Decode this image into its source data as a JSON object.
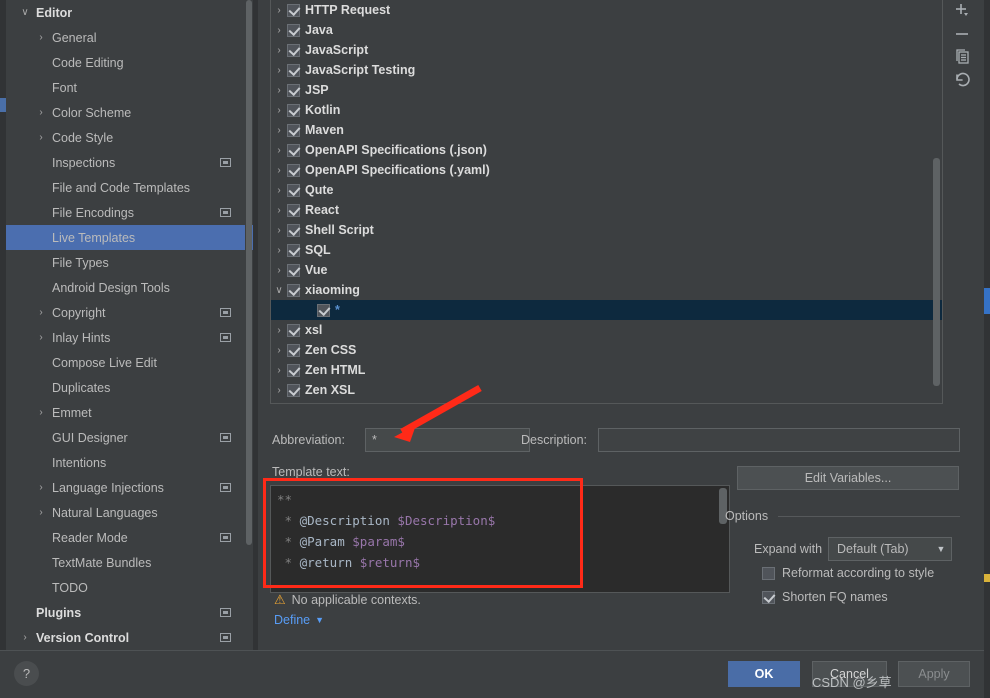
{
  "sidebar": {
    "items": [
      {
        "label": "Editor",
        "level": 0,
        "arrow": "chevron-down",
        "selected": false,
        "config": false
      },
      {
        "label": "General",
        "level": 1,
        "arrow": "chevron-right",
        "selected": false,
        "config": false
      },
      {
        "label": "Code Editing",
        "level": 1,
        "arrow": "",
        "selected": false,
        "config": false
      },
      {
        "label": "Font",
        "level": 1,
        "arrow": "",
        "selected": false,
        "config": false
      },
      {
        "label": "Color Scheme",
        "level": 1,
        "arrow": "chevron-right",
        "selected": false,
        "config": false
      },
      {
        "label": "Code Style",
        "level": 1,
        "arrow": "chevron-right",
        "selected": false,
        "config": false
      },
      {
        "label": "Inspections",
        "level": 1,
        "arrow": "",
        "selected": false,
        "config": true
      },
      {
        "label": "File and Code Templates",
        "level": 1,
        "arrow": "",
        "selected": false,
        "config": false
      },
      {
        "label": "File Encodings",
        "level": 1,
        "arrow": "",
        "selected": false,
        "config": true
      },
      {
        "label": "Live Templates",
        "level": 1,
        "arrow": "",
        "selected": true,
        "config": false
      },
      {
        "label": "File Types",
        "level": 1,
        "arrow": "",
        "selected": false,
        "config": false
      },
      {
        "label": "Android Design Tools",
        "level": 1,
        "arrow": "",
        "selected": false,
        "config": false
      },
      {
        "label": "Copyright",
        "level": 1,
        "arrow": "chevron-right",
        "selected": false,
        "config": true
      },
      {
        "label": "Inlay Hints",
        "level": 1,
        "arrow": "chevron-right",
        "selected": false,
        "config": true
      },
      {
        "label": "Compose Live Edit",
        "level": 1,
        "arrow": "",
        "selected": false,
        "config": false
      },
      {
        "label": "Duplicates",
        "level": 1,
        "arrow": "",
        "selected": false,
        "config": false
      },
      {
        "label": "Emmet",
        "level": 1,
        "arrow": "chevron-right",
        "selected": false,
        "config": false
      },
      {
        "label": "GUI Designer",
        "level": 1,
        "arrow": "",
        "selected": false,
        "config": true
      },
      {
        "label": "Intentions",
        "level": 1,
        "arrow": "",
        "selected": false,
        "config": false
      },
      {
        "label": "Language Injections",
        "level": 1,
        "arrow": "chevron-right",
        "selected": false,
        "config": true
      },
      {
        "label": "Natural Languages",
        "level": 1,
        "arrow": "chevron-right",
        "selected": false,
        "config": false
      },
      {
        "label": "Reader Mode",
        "level": 1,
        "arrow": "",
        "selected": false,
        "config": true
      },
      {
        "label": "TextMate Bundles",
        "level": 1,
        "arrow": "",
        "selected": false,
        "config": false
      },
      {
        "label": "TODO",
        "level": 1,
        "arrow": "",
        "selected": false,
        "config": false
      },
      {
        "label": "Plugins",
        "level": 0,
        "arrow": "",
        "selected": false,
        "config": true
      },
      {
        "label": "Version Control",
        "level": 0,
        "arrow": "chevron-right",
        "selected": false,
        "config": true
      }
    ]
  },
  "tree": {
    "rows": [
      {
        "label": "HTTP Request",
        "arrow": "chevron-right",
        "checked": true,
        "child": false,
        "selected": false
      },
      {
        "label": "Java",
        "arrow": "chevron-right",
        "checked": true,
        "child": false,
        "selected": false
      },
      {
        "label": "JavaScript",
        "arrow": "chevron-right",
        "checked": true,
        "child": false,
        "selected": false
      },
      {
        "label": "JavaScript Testing",
        "arrow": "chevron-right",
        "checked": true,
        "child": false,
        "selected": false
      },
      {
        "label": "JSP",
        "arrow": "chevron-right",
        "checked": true,
        "child": false,
        "selected": false
      },
      {
        "label": "Kotlin",
        "arrow": "chevron-right",
        "checked": true,
        "child": false,
        "selected": false
      },
      {
        "label": "Maven",
        "arrow": "chevron-right",
        "checked": true,
        "child": false,
        "selected": false
      },
      {
        "label": "OpenAPI Specifications (.json)",
        "arrow": "chevron-right",
        "checked": true,
        "child": false,
        "selected": false
      },
      {
        "label": "OpenAPI Specifications (.yaml)",
        "arrow": "chevron-right",
        "checked": true,
        "child": false,
        "selected": false
      },
      {
        "label": "Qute",
        "arrow": "chevron-right",
        "checked": true,
        "child": false,
        "selected": false
      },
      {
        "label": "React",
        "arrow": "chevron-right",
        "checked": true,
        "child": false,
        "selected": false
      },
      {
        "label": "Shell Script",
        "arrow": "chevron-right",
        "checked": true,
        "child": false,
        "selected": false
      },
      {
        "label": "SQL",
        "arrow": "chevron-right",
        "checked": true,
        "child": false,
        "selected": false
      },
      {
        "label": "Vue",
        "arrow": "chevron-right",
        "checked": true,
        "child": false,
        "selected": false
      },
      {
        "label": "xiaoming",
        "arrow": "chevron-down",
        "checked": true,
        "child": false,
        "selected": false
      },
      {
        "label": "*",
        "arrow": "",
        "checked": true,
        "child": true,
        "selected": true
      },
      {
        "label": "xsl",
        "arrow": "chevron-right",
        "checked": true,
        "child": false,
        "selected": false
      },
      {
        "label": "Zen CSS",
        "arrow": "chevron-right",
        "checked": true,
        "child": false,
        "selected": false
      },
      {
        "label": "Zen HTML",
        "arrow": "chevron-right",
        "checked": true,
        "child": false,
        "selected": false
      },
      {
        "label": "Zen XSL",
        "arrow": "chevron-right",
        "checked": true,
        "child": false,
        "selected": false
      }
    ]
  },
  "toolbar": {
    "add": "add-icon",
    "remove": "remove-icon",
    "duplicate": "duplicate-icon",
    "revert": "revert-icon"
  },
  "form": {
    "abbreviation_label": "Abbreviation:",
    "abbreviation_value": "*",
    "description_label": "Description:",
    "description_value": "",
    "template_text_label": "Template text:",
    "template_lines": [
      {
        "prefix": "**",
        "tag": "",
        "var": ""
      },
      {
        "prefix": " * ",
        "tag": "@Description ",
        "var": "$Description$"
      },
      {
        "prefix": " * ",
        "tag": "@Param ",
        "var": "$param$"
      },
      {
        "prefix": " * ",
        "tag": "@return ",
        "var": "$return$"
      }
    ],
    "warning": "No applicable contexts.",
    "define_label": "Define",
    "edit_variables_label": "Edit Variables...",
    "options_label": "Options",
    "expand_with_label": "Expand with",
    "expand_with_value": "Default (Tab)",
    "reformat_label": "Reformat according to style",
    "reformat_checked": false,
    "shorten_label": "Shorten FQ names",
    "shorten_checked": true
  },
  "footer": {
    "help": "?",
    "ok": "OK",
    "cancel": "Cancel",
    "apply": "Apply",
    "watermark": "CSDN @乡草"
  },
  "colors": {
    "accent": "#4a6da7",
    "selection": "#4b6eaf",
    "tree_selection": "#0d293e",
    "annotation": "#ff2a18",
    "link": "#589df6",
    "warning": "#f0a732"
  }
}
